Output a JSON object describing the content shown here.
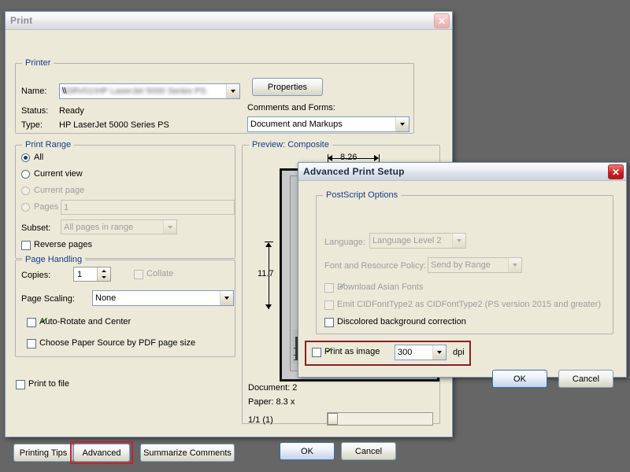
{
  "desktop": {
    "background": "#666666"
  },
  "print_dialog": {
    "title": "Print",
    "close_label": "✕",
    "printer_group": {
      "legend": "Printer",
      "name_label": "Name:",
      "name_prefix": "\\\\",
      "name_value_redacted": "\\\\SRV01\\HP LaserJet 5000 Series PS",
      "status_label": "Status:",
      "status_value": "Ready",
      "type_label": "Type:",
      "type_value": "HP LaserJet 5000 Series PS",
      "properties_button": "Properties",
      "comments_label": "Comments and Forms:",
      "comments_value": "Document and Markups"
    },
    "print_range_group": {
      "legend": "Print Range",
      "options": [
        {
          "label": "All",
          "selected": true,
          "enabled": true
        },
        {
          "label": "Current view",
          "selected": false,
          "enabled": true
        },
        {
          "label": "Current page",
          "selected": false,
          "enabled": false
        },
        {
          "label": "Pages",
          "selected": false,
          "enabled": false
        }
      ],
      "pages_value": "1",
      "subset_label": "Subset:",
      "subset_value": "All pages in range",
      "reverse_pages_label": "Reverse pages",
      "reverse_pages_checked": false
    },
    "page_handling_group": {
      "legend": "Page Handling",
      "copies_label": "Copies:",
      "copies_value": "1",
      "collate_label": "Collate",
      "collate_checked": false,
      "collate_enabled": false,
      "page_scaling_label": "Page Scaling:",
      "page_scaling_value": "None",
      "auto_rotate_label": "Auto-Rotate and Center",
      "auto_rotate_checked": true,
      "paper_source_label": "Choose Paper Source by PDF page size",
      "paper_source_checked": false
    },
    "print_to_file_label": "Print to file",
    "print_to_file_checked": false,
    "preview_group": {
      "legend": "Preview: Composite",
      "width_dim": "8.26",
      "height_dim": "11.7",
      "document_label": "Document: 2",
      "paper_label": "Paper: 8.3 x",
      "page_counter": "1/1 (1)"
    },
    "footer_buttons": {
      "printing_tips": "Printing Tips",
      "advanced": "Advanced",
      "advanced_highlight_color": "#c0272d",
      "summarize_comments": "Summarize Comments",
      "ok": "OK",
      "cancel": "Cancel"
    }
  },
  "advanced_dialog": {
    "title": "Advanced Print Setup",
    "close_label": "✕",
    "postscript_group": {
      "legend": "PostScript Options",
      "language_label": "Language:",
      "language_value": "Language Level 2",
      "language_enabled": false,
      "font_policy_label": "Font and Resource Policy:",
      "font_policy_value": "Send by Range",
      "font_policy_enabled": false,
      "download_asian_fonts_label": "Download Asian Fonts",
      "download_asian_fonts_checked": true,
      "download_asian_fonts_enabled": false,
      "emit_cid_label": "Emit CIDFontType2 as CIDFontType2 (PS version 2015 and greater)",
      "emit_cid_checked": false,
      "emit_cid_enabled": false,
      "discolored_label": "Discolored background correction",
      "discolored_checked": false,
      "discolored_enabled": true
    },
    "print_as_image": {
      "label": "Print as image",
      "checked": true,
      "dpi_value": "300",
      "dpi_unit": "dpi",
      "highlight_color": "#c0272d"
    },
    "ok": "OK",
    "cancel": "Cancel"
  }
}
